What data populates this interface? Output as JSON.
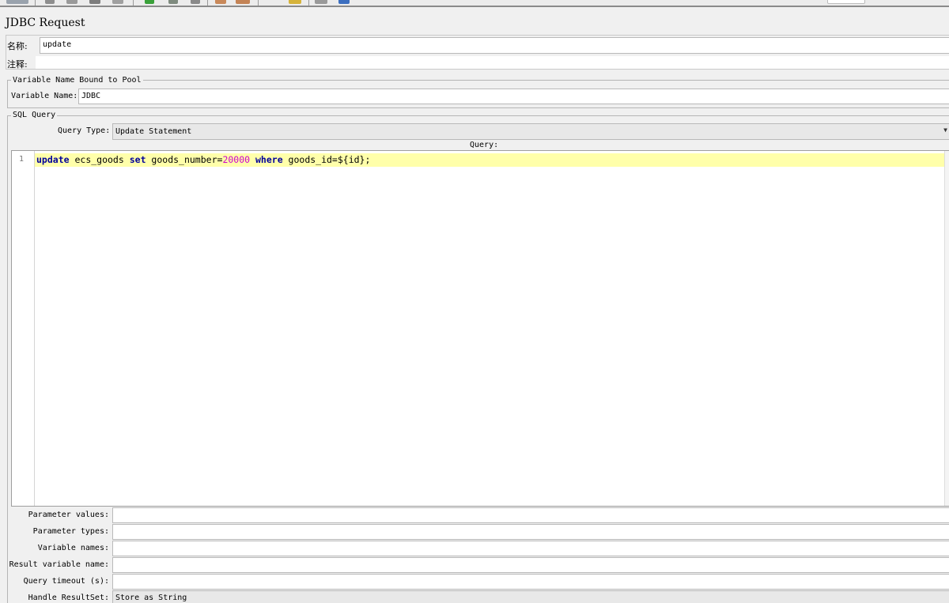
{
  "header": {
    "title": "JDBC Request"
  },
  "name_panel": {
    "name_label": "名称:",
    "name_value": "update",
    "comment_label": "注释:",
    "comment_value": ""
  },
  "pool_group": {
    "legend": "Variable Name Bound to Pool",
    "variable_label": "Variable Name:",
    "variable_value": "JDBC"
  },
  "sql_group": {
    "legend": "SQL Query",
    "query_type_label": "Query Type:",
    "query_type_value": "Update Statement",
    "query_label": "Query:",
    "line_number": "1",
    "code": {
      "kw1": "update",
      "t1": " ecs_goods ",
      "kw2": "set",
      "t2": " goods_number=",
      "n1": "20000",
      "t3": " ",
      "kw3": "where",
      "t4": " goods_id=${id};"
    }
  },
  "params": {
    "parameter_values_label": "Parameter values:",
    "parameter_values": "",
    "parameter_types_label": "Parameter types:",
    "parameter_types": "",
    "variable_names_label": "Variable names:",
    "variable_names": "",
    "result_variable_label": "Result variable name:",
    "result_variable": "",
    "query_timeout_label": "Query timeout (s):",
    "query_timeout": "",
    "handle_resultset_label": "Handle ResultSet:",
    "handle_resultset": "Store as String"
  }
}
